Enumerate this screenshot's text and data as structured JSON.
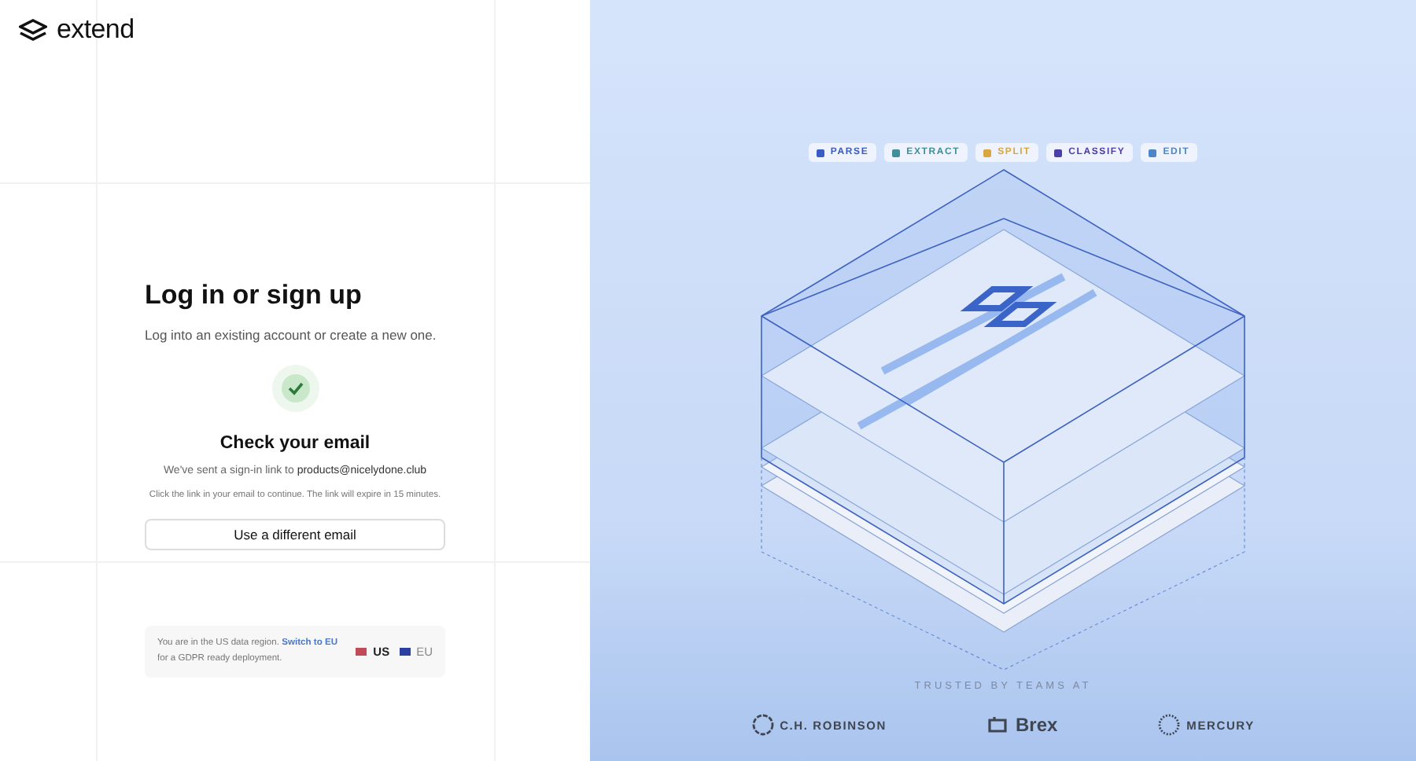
{
  "brand": {
    "name": "extend"
  },
  "login": {
    "title": "Log in or sign up",
    "subtitle": "Log into an existing account or create a new one.",
    "check_title": "Check your email",
    "sent_text": "We've sent a sign-in link to",
    "email": "products@nicelydone.club",
    "note": "Click the link in your email to continue. The link will expire in 15 minutes.",
    "button": "Use a different email"
  },
  "region": {
    "text": "You are in the US data region.",
    "link": "Switch to EU",
    "suffix": "for a GDPR ready deployment.",
    "options": [
      {
        "label": "US",
        "selected": true
      },
      {
        "label": "EU",
        "selected": false
      }
    ]
  },
  "features": [
    {
      "label": "PARSE",
      "color": "#3b5bc4"
    },
    {
      "label": "EXTRACT",
      "color": "#3f8f9a"
    },
    {
      "label": "SPLIT",
      "color": "#d9a640"
    },
    {
      "label": "CLASSIFY",
      "color": "#4a3fa8"
    },
    {
      "label": "EDIT",
      "color": "#4a86c8"
    }
  ],
  "trusted": {
    "heading": "TRUSTED BY TEAMS AT",
    "logos": [
      "C.H. ROBINSON",
      "Brex",
      "MERCURY"
    ]
  }
}
